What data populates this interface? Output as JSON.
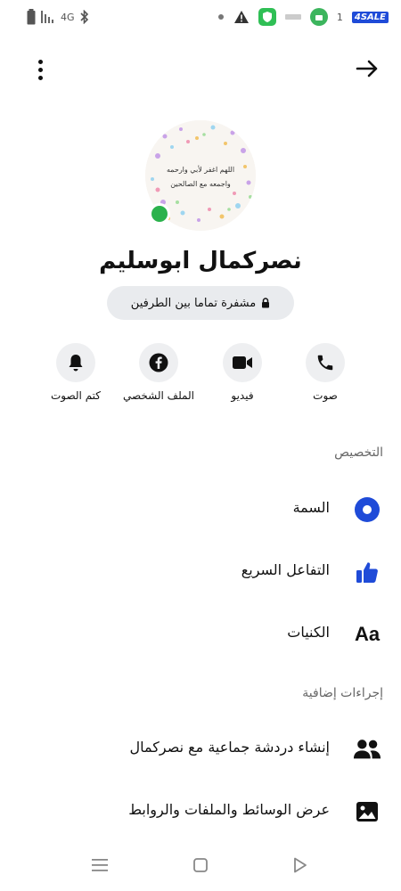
{
  "status_bar": {
    "signal_text": "Il",
    "carrier_text": "4G",
    "small_label": "1",
    "sale_badge": "4SALE",
    "icons": [
      "battery-icon",
      "signal-icon",
      "bluetooth-icon",
      "dot-icon",
      "warning-icon",
      "shield-app-icon",
      "notification-icon",
      "app-icon"
    ]
  },
  "header": {
    "more_icon": "more-vertical-icon",
    "forward_icon": "arrow-right-icon"
  },
  "profile": {
    "name": "نصركمال ابوسليم",
    "online_color": "#2bb24c",
    "avatar_text_line1": "اللهم اغفر لأبي وارحمه",
    "avatar_text_line2": "واجمعه مع الصالحين",
    "encryption_label": "مشفرة تماما بين الطرفين"
  },
  "actions": [
    {
      "label": "صوت",
      "icon": "phone-icon"
    },
    {
      "label": "فيديو",
      "icon": "video-icon"
    },
    {
      "label": "الملف الشخصي",
      "icon": "facebook-icon"
    },
    {
      "label": "كتم الصوت",
      "icon": "bell-icon"
    }
  ],
  "customization": {
    "title": "التخصيص",
    "items": [
      {
        "label": "السمة",
        "icon": "theme-icon",
        "color": "#1f4bd8"
      },
      {
        "label": "التفاعل السريع",
        "icon": "thumbs-up-icon",
        "color": "#1f4bd8"
      },
      {
        "label": "الكنيات",
        "icon": "nicknames-icon",
        "glyph": "Aa"
      }
    ]
  },
  "more_actions": {
    "title": "إجراءات إضافية",
    "items": [
      {
        "label": "إنشاء دردشة جماعية مع نصركمال",
        "icon": "group-icon"
      },
      {
        "label": "عرض الوسائط والملفات والروابط",
        "icon": "image-icon"
      }
    ]
  },
  "nav_bar": {
    "icons": [
      "menu-icon",
      "home-icon",
      "back-icon"
    ]
  }
}
